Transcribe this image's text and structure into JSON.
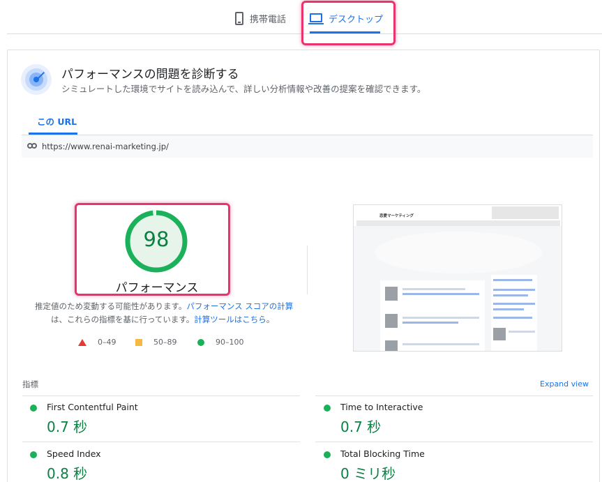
{
  "device_tabs": {
    "mobile": {
      "label": "携帯電話",
      "icon": "phone-icon"
    },
    "desktop": {
      "label": "デスクトップ",
      "icon": "laptop-icon",
      "selected": true
    }
  },
  "diagnose": {
    "title": "パフォーマンスの問題を診断する",
    "subtitle": "シミュレートした環境でサイトを読み込んで、詳しい分析情報や改善の提案を確認できます。"
  },
  "url_tab": {
    "label": "この URL"
  },
  "url": {
    "value": "https://www.renai-marketing.jp/",
    "icon": "link-icon"
  },
  "score": {
    "value": "98",
    "label": "パフォーマンス",
    "fraction": 0.98,
    "color": "#0b8043"
  },
  "notes": {
    "line1_prefix": "推定値のため変動する可能性があります。",
    "line1_link": "パフォーマンス スコアの計算",
    "line2_prefix": "は、これらの指標を基に行っています。",
    "line2_link": "計算ツールはこちら",
    "line2_suffix": "。"
  },
  "legend": [
    {
      "range": "0–49",
      "shape": "triangle",
      "color": "#e53935"
    },
    {
      "range": "50–89",
      "shape": "square",
      "color": "#f5b942"
    },
    {
      "range": "90–100",
      "shape": "circle",
      "color": "#1bb05a"
    }
  ],
  "thumbnail": {
    "site_name": "恋愛マーケティング"
  },
  "metrics": {
    "title": "指標",
    "expand_label": "Expand view",
    "items": [
      {
        "name": "First Contentful Paint",
        "value": "0.7 秒"
      },
      {
        "name": "Time to Interactive",
        "value": "0.7 秒"
      },
      {
        "name": "Speed Index",
        "value": "0.8 秒"
      },
      {
        "name": "Total Blocking Time",
        "value": "0 ミリ秒"
      }
    ]
  },
  "colors": {
    "accent": "#1a73e8",
    "good": "#0b8043",
    "highlight": "#e8336d"
  }
}
